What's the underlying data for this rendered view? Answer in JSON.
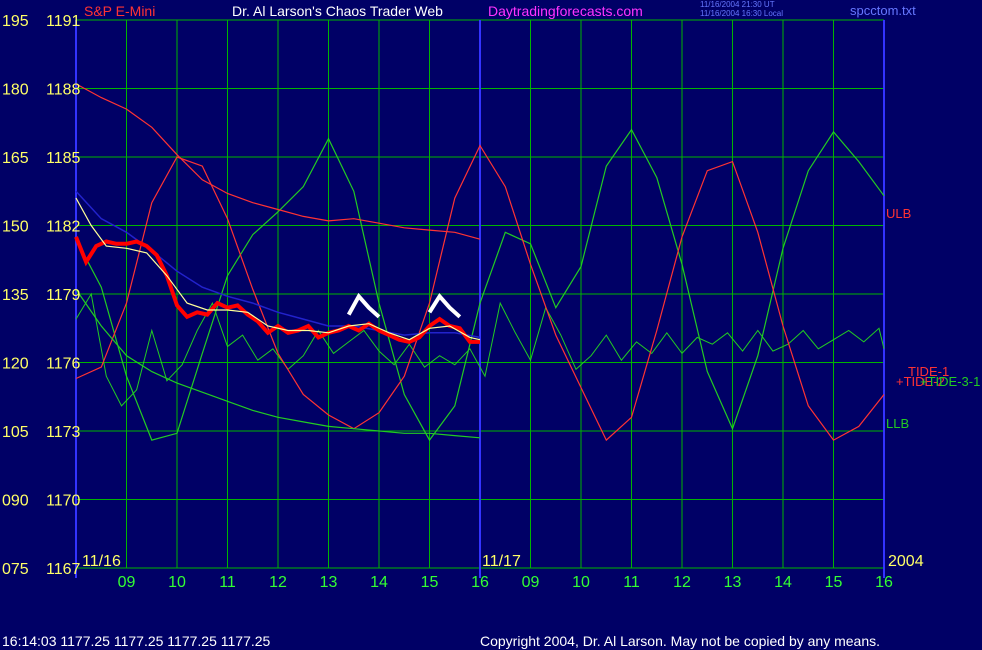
{
  "header": {
    "symbol": "S&P E-Mini",
    "title": "Dr. Al Larson's Chaos Trader Web",
    "site": "Daytradingforecasts.com",
    "time_ut": "11/16/2004 21:30 UT",
    "time_local": "11/16/2004 16:30 Local",
    "file": "spcctom.txt"
  },
  "footer": {
    "quote": "16:14:03  1177.25 1177.25 1177.25 1177.25",
    "copyright": "Copyright 2004, Dr. Al Larson. May not be copied by any means."
  },
  "colors": {
    "background": "#000066",
    "grid": "#00b400",
    "axis_border": "#3333ff",
    "price_up": "#ff0000",
    "price_down": "#ffffff",
    "average": "#ffff99",
    "ma": "#2222cc",
    "band": "#ff3333",
    "flux": "#22cc22",
    "y_labels": "#ffff66",
    "x_labels": "#33ff33",
    "site_link": "#ff33ff",
    "file_label": "#6677ff"
  },
  "chart_data": {
    "type": "line",
    "y_left_labels": [
      "195",
      "180",
      "165",
      "150",
      "135",
      "120",
      "105",
      "090",
      "075"
    ],
    "y_price_labels": [
      "1191",
      "1188",
      "1185",
      "1182",
      "1179",
      "1176",
      "1173",
      "1170",
      "1167"
    ],
    "ylim": [
      1167,
      1191
    ],
    "x_ticks": [
      "09",
      "10",
      "11",
      "12",
      "13",
      "14",
      "15",
      "16",
      "09",
      "10",
      "11",
      "12",
      "13",
      "14",
      "15",
      "16"
    ],
    "date_labels": [
      "11/16",
      "11/17",
      "2004"
    ],
    "xlim": [
      0,
      16
    ],
    "now_x": 8,
    "series_labels": [
      {
        "text": "ULB",
        "color": "#ff3333"
      },
      {
        "text": "TIDE-1",
        "color": "#ff3333"
      },
      {
        "text": "+TIDE-2",
        "color": "#ff3333"
      },
      {
        "text": "+TIDE-3-1",
        "color": "#22cc22"
      },
      {
        "text": "LLB",
        "color": "#22cc22"
      }
    ],
    "price": [
      [
        0,
        1181.5
      ],
      [
        0.2,
        1180.4
      ],
      [
        0.4,
        1181.1
      ],
      [
        0.6,
        1181.3
      ],
      [
        0.8,
        1181.2
      ],
      [
        1.0,
        1181.2
      ],
      [
        1.2,
        1181.3
      ],
      [
        1.4,
        1181.1
      ],
      [
        1.6,
        1180.7
      ],
      [
        1.8,
        1179.8
      ],
      [
        2.0,
        1178.5
      ],
      [
        2.2,
        1178.0
      ],
      [
        2.4,
        1178.2
      ],
      [
        2.6,
        1178.1
      ],
      [
        2.8,
        1178.6
      ],
      [
        3.0,
        1178.4
      ],
      [
        3.2,
        1178.5
      ],
      [
        3.4,
        1178.1
      ],
      [
        3.6,
        1177.8
      ],
      [
        3.8,
        1177.3
      ],
      [
        4.0,
        1177.6
      ],
      [
        4.2,
        1177.3
      ],
      [
        4.4,
        1177.4
      ],
      [
        4.6,
        1177.6
      ],
      [
        4.8,
        1177.1
      ],
      [
        5.0,
        1177.3
      ],
      [
        5.2,
        1177.4
      ],
      [
        5.4,
        1177.6
      ],
      [
        5.6,
        1177.4
      ],
      [
        5.8,
        1177.7
      ],
      [
        6.0,
        1177.4
      ],
      [
        6.2,
        1177.2
      ],
      [
        6.4,
        1177.0
      ],
      [
        6.6,
        1176.9
      ],
      [
        6.8,
        1177.1
      ],
      [
        7.0,
        1177.6
      ],
      [
        7.2,
        1177.9
      ],
      [
        7.4,
        1177.6
      ],
      [
        7.6,
        1177.5
      ],
      [
        7.8,
        1176.9
      ],
      [
        8.0,
        1176.9
      ]
    ],
    "price_white": [
      [
        5.4,
        1178.1
      ],
      [
        5.6,
        1178.9
      ],
      [
        5.8,
        1178.4
      ],
      [
        6.0,
        1178.0
      ],
      [
        7.0,
        1178.2
      ],
      [
        7.2,
        1178.9
      ],
      [
        7.4,
        1178.4
      ],
      [
        7.6,
        1178.0
      ]
    ],
    "average": [
      [
        0,
        1183.2
      ],
      [
        0.3,
        1182.0
      ],
      [
        0.6,
        1181.1
      ],
      [
        1.0,
        1181.0
      ],
      [
        1.4,
        1180.8
      ],
      [
        1.8,
        1179.8
      ],
      [
        2.2,
        1178.6
      ],
      [
        2.6,
        1178.3
      ],
      [
        3.0,
        1178.3
      ],
      [
        3.4,
        1178.2
      ],
      [
        3.8,
        1177.6
      ],
      [
        4.2,
        1177.4
      ],
      [
        4.6,
        1177.4
      ],
      [
        5.0,
        1177.3
      ],
      [
        5.4,
        1177.6
      ],
      [
        5.8,
        1177.7
      ],
      [
        6.2,
        1177.3
      ],
      [
        6.6,
        1177.0
      ],
      [
        7.0,
        1177.5
      ],
      [
        7.4,
        1177.6
      ],
      [
        7.8,
        1177.1
      ],
      [
        8.0,
        1177.0
      ]
    ],
    "moving_average": [
      [
        0,
        1183.5
      ],
      [
        0.5,
        1182.3
      ],
      [
        1.0,
        1181.7
      ],
      [
        1.5,
        1180.9
      ],
      [
        2.0,
        1180.0
      ],
      [
        2.5,
        1179.3
      ],
      [
        3.0,
        1178.9
      ],
      [
        3.5,
        1178.6
      ],
      [
        4.0,
        1178.2
      ],
      [
        4.5,
        1177.9
      ],
      [
        5.0,
        1177.6
      ],
      [
        5.5,
        1177.6
      ],
      [
        6.0,
        1177.4
      ],
      [
        6.5,
        1177.2
      ],
      [
        7.0,
        1177.3
      ],
      [
        7.5,
        1177.3
      ],
      [
        8.0,
        1177.1
      ]
    ],
    "upper_band": [
      [
        0,
        1188.2
      ],
      [
        0.5,
        1187.6
      ],
      [
        1.0,
        1187.1
      ],
      [
        1.5,
        1186.3
      ],
      [
        2.0,
        1185.1
      ],
      [
        2.5,
        1184.0
      ],
      [
        3.0,
        1183.4
      ],
      [
        3.5,
        1183.0
      ],
      [
        4.0,
        1182.7
      ],
      [
        4.5,
        1182.4
      ],
      [
        5.0,
        1182.2
      ],
      [
        5.5,
        1182.3
      ],
      [
        6.0,
        1182.1
      ],
      [
        6.5,
        1181.9
      ],
      [
        7.0,
        1181.8
      ],
      [
        7.5,
        1181.7
      ],
      [
        8.0,
        1181.4
      ]
    ],
    "lower_band": [
      [
        0,
        1179.2
      ],
      [
        0.5,
        1177.6
      ],
      [
        1.0,
        1176.3
      ],
      [
        1.5,
        1175.6
      ],
      [
        2.0,
        1175.1
      ],
      [
        2.5,
        1174.7
      ],
      [
        3.0,
        1174.3
      ],
      [
        3.5,
        1173.9
      ],
      [
        4.0,
        1173.6
      ],
      [
        4.5,
        1173.4
      ],
      [
        5.0,
        1173.2
      ],
      [
        5.5,
        1173.1
      ],
      [
        6.0,
        1173.0
      ],
      [
        6.5,
        1172.9
      ],
      [
        7.0,
        1172.9
      ],
      [
        7.5,
        1172.8
      ],
      [
        8.0,
        1172.7
      ]
    ],
    "tide_red": [
      [
        0,
        1175.3
      ],
      [
        0.5,
        1175.8
      ],
      [
        1.0,
        1178.6
      ],
      [
        1.5,
        1183.0
      ],
      [
        2.0,
        1185.0
      ],
      [
        2.5,
        1184.6
      ],
      [
        3.0,
        1182.3
      ],
      [
        3.5,
        1179.2
      ],
      [
        4.0,
        1176.4
      ],
      [
        4.5,
        1174.6
      ],
      [
        5.0,
        1173.7
      ],
      [
        5.5,
        1173.1
      ],
      [
        6.0,
        1173.8
      ],
      [
        6.5,
        1175.4
      ],
      [
        7.0,
        1178.6
      ],
      [
        7.5,
        1183.2
      ],
      [
        8.0,
        1185.5
      ],
      [
        8.5,
        1183.7
      ],
      [
        9.0,
        1180.3
      ],
      [
        9.5,
        1177.2
      ],
      [
        10.0,
        1174.9
      ],
      [
        10.5,
        1172.6
      ],
      [
        11.0,
        1173.6
      ],
      [
        11.5,
        1177.4
      ],
      [
        12.0,
        1181.5
      ],
      [
        12.5,
        1184.4
      ],
      [
        13.0,
        1184.8
      ],
      [
        13.5,
        1181.7
      ],
      [
        14.0,
        1177.6
      ],
      [
        14.5,
        1174.1
      ],
      [
        15.0,
        1172.6
      ],
      [
        15.5,
        1173.2
      ],
      [
        16.0,
        1174.6
      ]
    ],
    "tide_green": [
      [
        0,
        1181.4
      ],
      [
        0.5,
        1179.3
      ],
      [
        1.0,
        1175.4
      ],
      [
        1.5,
        1172.6
      ],
      [
        2.0,
        1172.9
      ],
      [
        2.5,
        1176.4
      ],
      [
        3.0,
        1179.8
      ],
      [
        3.5,
        1181.6
      ],
      [
        4.0,
        1182.6
      ],
      [
        4.5,
        1183.7
      ],
      [
        5.0,
        1185.8
      ],
      [
        5.5,
        1183.5
      ],
      [
        6.0,
        1178.6
      ],
      [
        6.5,
        1174.6
      ],
      [
        7.0,
        1172.6
      ],
      [
        7.5,
        1174.1
      ],
      [
        8.0,
        1178.6
      ],
      [
        8.5,
        1181.7
      ],
      [
        9.0,
        1181.2
      ],
      [
        9.5,
        1178.4
      ],
      [
        10.0,
        1180.2
      ],
      [
        10.5,
        1184.6
      ],
      [
        11.0,
        1186.2
      ],
      [
        11.5,
        1184.1
      ],
      [
        12.0,
        1180.3
      ],
      [
        12.5,
        1175.6
      ],
      [
        13.0,
        1173.1
      ],
      [
        13.5,
        1176.3
      ],
      [
        14.0,
        1181.0
      ],
      [
        14.5,
        1184.4
      ],
      [
        15.0,
        1186.1
      ],
      [
        15.5,
        1184.8
      ],
      [
        16.0,
        1183.3
      ]
    ],
    "flux": [
      [
        0,
        1177.9
      ],
      [
        0.3,
        1179.0
      ],
      [
        0.6,
        1175.4
      ],
      [
        0.9,
        1174.1
      ],
      [
        1.2,
        1174.8
      ],
      [
        1.5,
        1177.4
      ],
      [
        1.8,
        1175.2
      ],
      [
        2.1,
        1175.9
      ],
      [
        2.4,
        1177.4
      ],
      [
        2.7,
        1178.6
      ],
      [
        3.0,
        1176.7
      ],
      [
        3.3,
        1177.2
      ],
      [
        3.6,
        1176.1
      ],
      [
        3.9,
        1176.6
      ],
      [
        4.2,
        1175.7
      ],
      [
        4.5,
        1176.3
      ],
      [
        4.8,
        1177.4
      ],
      [
        5.1,
        1176.4
      ],
      [
        5.4,
        1176.9
      ],
      [
        5.7,
        1177.4
      ],
      [
        6.0,
        1176.5
      ],
      [
        6.3,
        1175.9
      ],
      [
        6.6,
        1176.8
      ],
      [
        6.9,
        1175.8
      ],
      [
        7.2,
        1176.3
      ],
      [
        7.5,
        1175.9
      ],
      [
        7.8,
        1176.6
      ],
      [
        8.1,
        1175.4
      ],
      [
        8.4,
        1178.6
      ],
      [
        8.7,
        1177.3
      ],
      [
        9.0,
        1176.1
      ],
      [
        9.3,
        1178.4
      ],
      [
        9.6,
        1177.2
      ],
      [
        9.9,
        1175.7
      ],
      [
        10.2,
        1176.3
      ],
      [
        10.5,
        1177.2
      ],
      [
        10.8,
        1176.1
      ],
      [
        11.1,
        1176.9
      ],
      [
        11.4,
        1176.4
      ],
      [
        11.7,
        1177.3
      ],
      [
        12.0,
        1176.4
      ],
      [
        12.3,
        1177.1
      ],
      [
        12.6,
        1176.8
      ],
      [
        12.9,
        1177.3
      ],
      [
        13.2,
        1176.5
      ],
      [
        13.5,
        1177.4
      ],
      [
        13.8,
        1176.5
      ],
      [
        14.1,
        1176.8
      ],
      [
        14.4,
        1177.4
      ],
      [
        14.7,
        1176.6
      ],
      [
        15.0,
        1177.0
      ],
      [
        15.3,
        1177.4
      ],
      [
        15.6,
        1176.9
      ],
      [
        15.9,
        1177.5
      ],
      [
        16.0,
        1176.6
      ]
    ],
    "grid": true
  }
}
